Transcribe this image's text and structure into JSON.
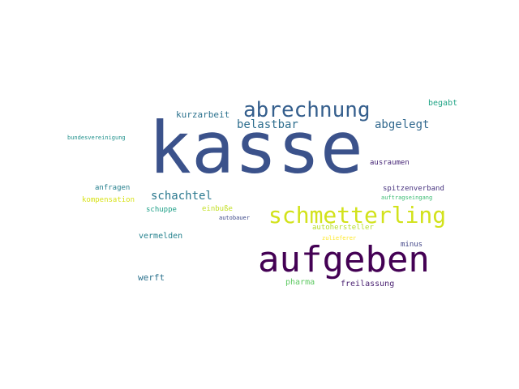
{
  "words": [
    {
      "id": "w-kasse",
      "text": "kasse",
      "color": "#3b528b"
    },
    {
      "id": "w-aufgeben",
      "text": "aufgeben",
      "color": "#440154"
    },
    {
      "id": "w-schmetterling",
      "text": "schmetterling",
      "color": "#d2e21b"
    },
    {
      "id": "w-abrechnung",
      "text": "abrechnung",
      "color": "#355f8d"
    },
    {
      "id": "w-belastbar",
      "text": "belastbar",
      "color": "#2e6e8e"
    },
    {
      "id": "w-abgelegt",
      "text": "abgelegt",
      "color": "#31688e"
    },
    {
      "id": "w-schachtel",
      "text": "schachtel",
      "color": "#2a788e"
    },
    {
      "id": "w-kurzarbeit",
      "text": "kurzarbeit",
      "color": "#2c728e"
    },
    {
      "id": "w-begabt",
      "text": "begabt",
      "color": "#20a486"
    },
    {
      "id": "w-bundesvereinigung",
      "text": "bundesvereinigung",
      "color": "#21918c"
    },
    {
      "id": "w-ausraumen",
      "text": "ausraumen",
      "color": "#482878"
    },
    {
      "id": "w-anfragen",
      "text": "anfragen",
      "color": "#27808e"
    },
    {
      "id": "w-spitzenverband",
      "text": "spitzenverband",
      "color": "#46327e"
    },
    {
      "id": "w-kompensation",
      "text": "kompensation",
      "color": "#d8e219"
    },
    {
      "id": "w-auftragseingang",
      "text": "auftragseingang",
      "color": "#3dbc74"
    },
    {
      "id": "w-schuppe",
      "text": "schuppe",
      "color": "#1fa088"
    },
    {
      "id": "w-einbusse",
      "text": "einbuße",
      "color": "#c2df23"
    },
    {
      "id": "w-autobauer",
      "text": "autobauer",
      "color": "#3e4989"
    },
    {
      "id": "w-autohersteller",
      "text": "autohersteller",
      "color": "#b5de2b"
    },
    {
      "id": "w-vermelden",
      "text": "vermelden",
      "color": "#26828e"
    },
    {
      "id": "w-zulieferer",
      "text": "zulieferer",
      "color": "#fde725"
    },
    {
      "id": "w-minus",
      "text": "minus",
      "color": "#414487"
    },
    {
      "id": "w-werft",
      "text": "werft",
      "color": "#2c728e"
    },
    {
      "id": "w-pharma",
      "text": "pharma",
      "color": "#5ec962"
    },
    {
      "id": "w-freilassung",
      "text": "freilassung",
      "color": "#481f70"
    }
  ]
}
